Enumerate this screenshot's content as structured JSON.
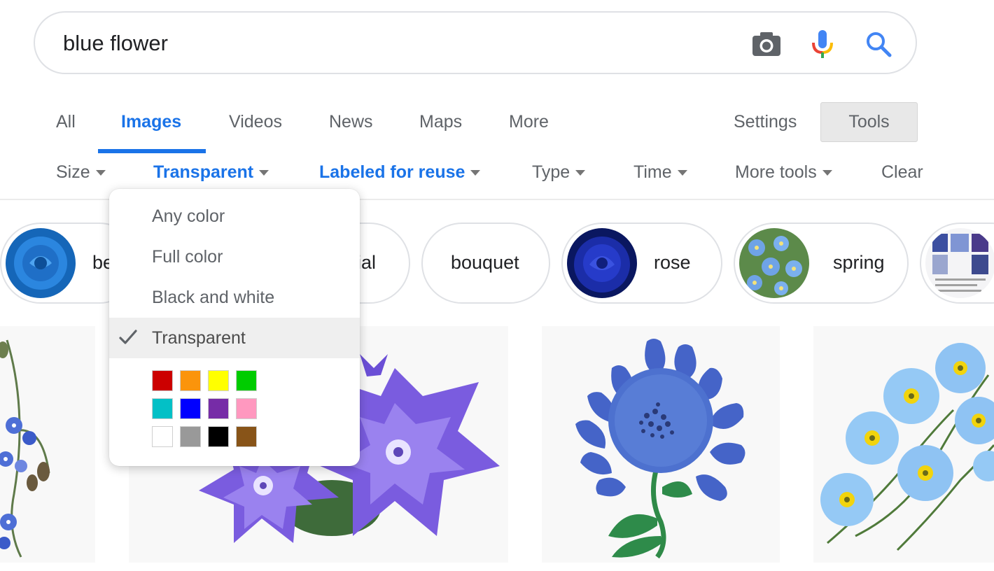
{
  "search": {
    "query": "blue flower"
  },
  "tabs": [
    {
      "label": "All"
    },
    {
      "label": "Images"
    },
    {
      "label": "Videos"
    },
    {
      "label": "News"
    },
    {
      "label": "Maps"
    },
    {
      "label": "More"
    }
  ],
  "header_right": {
    "settings_label": "Settings",
    "tools_label": "Tools"
  },
  "filters": [
    {
      "label": "Size"
    },
    {
      "label": "Transparent"
    },
    {
      "label": "Labeled for reuse"
    },
    {
      "label": "Type"
    },
    {
      "label": "Time"
    },
    {
      "label": "More tools"
    },
    {
      "label": "Clear"
    }
  ],
  "color_menu": {
    "options": [
      {
        "label": "Any color"
      },
      {
        "label": "Full color"
      },
      {
        "label": "Black and white"
      },
      {
        "label": "Transparent",
        "checked": true
      }
    ],
    "swatches": [
      "#cc0000",
      "#fb940b",
      "#ffff00",
      "#00cc00",
      "#03c0c6",
      "#0000ff",
      "#762ca7",
      "#ff98bf",
      "#ffffff",
      "#999999",
      "#000000",
      "#885418"
    ]
  },
  "chips": [
    {
      "label": "be"
    },
    {
      "label": "ial"
    },
    {
      "label": "bouquet"
    },
    {
      "label": "rose"
    },
    {
      "label": "spring"
    }
  ],
  "colors": {
    "accent": "#1a73e8",
    "muted_text": "#5f6368"
  }
}
